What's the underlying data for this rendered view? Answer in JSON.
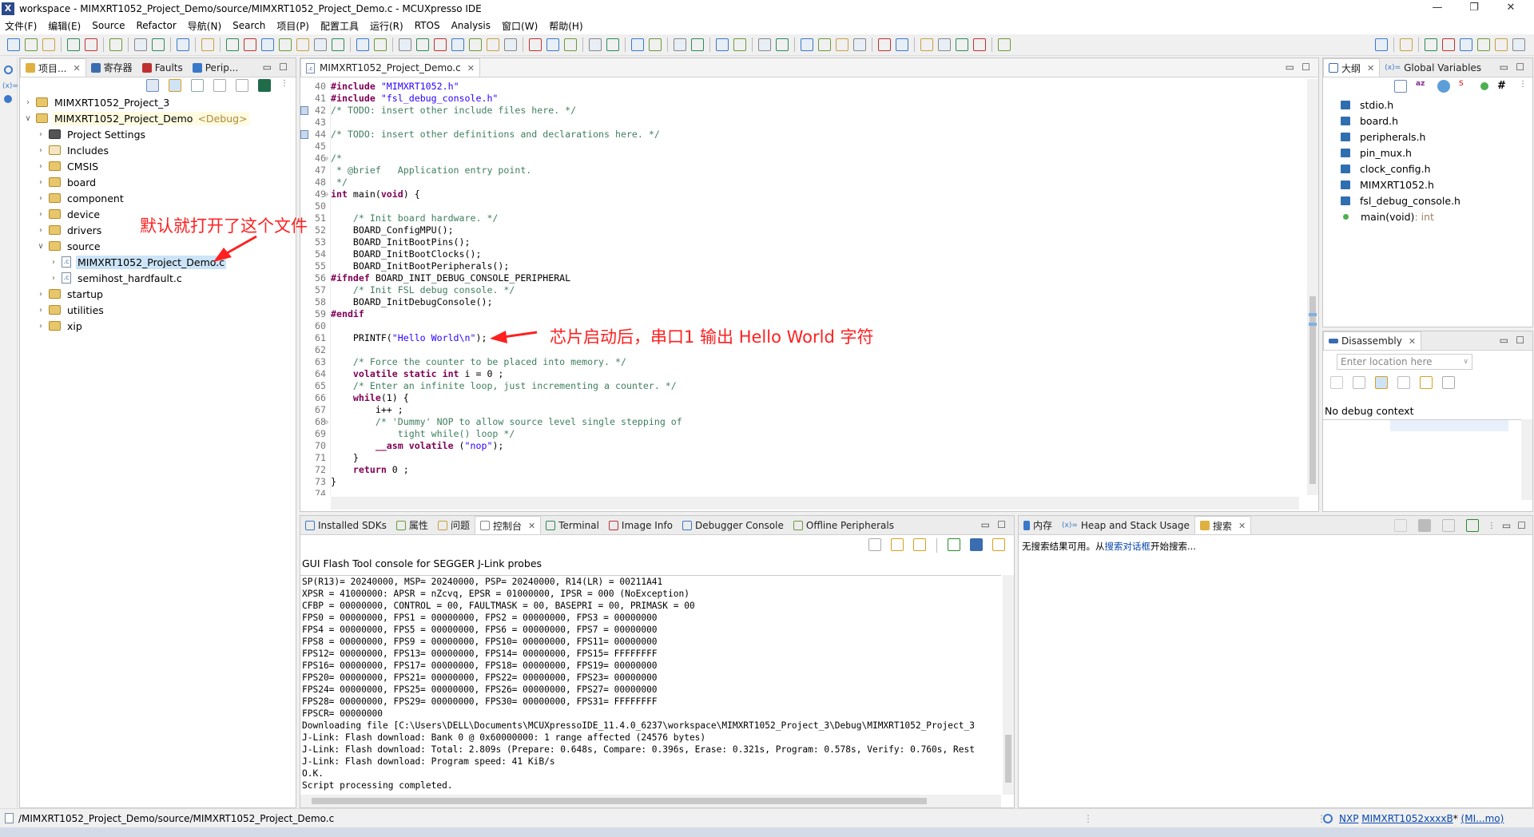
{
  "window": {
    "title": "workspace - MIMXRT1052_Project_Demo/source/MIMXRT1052_Project_Demo.c - MCUXpresso IDE",
    "logo": "X",
    "minimize": "—",
    "restore": "❐",
    "close": "✕"
  },
  "menu": [
    "文件(F)",
    "编辑(E)",
    "Source",
    "Refactor",
    "导航(N)",
    "Search",
    "项目(P)",
    "配置工具",
    "运行(R)",
    "RTOS",
    "Analysis",
    "窗口(W)",
    "帮助(H)"
  ],
  "toolbar_icons": [
    "new-icon",
    "save-icon",
    "save-all-icon",
    "sep",
    "build-config-icon",
    "build-icon",
    "sep",
    "binary-icon",
    "sep",
    "undo-icon",
    "redo-icon",
    "sep",
    "terminal-icon",
    "sep",
    "debug-skip-icon",
    "sep",
    "resume-icon",
    "suspend-icon",
    "stop-icon",
    "disconnect-icon",
    "step-into-icon",
    "step-over-icon",
    "step-return-icon",
    "sep",
    "instruction-step-icon",
    "drop-frame-icon",
    "sep",
    "restart-icon",
    "split-icon",
    "copy-icon",
    "step-icon",
    "step2-icon",
    "step3-icon",
    "step-out-icon",
    "sep",
    "mcuxpresso-icon",
    "globe-icon",
    "home-icon",
    "sep",
    "link-icon",
    "probe-icon",
    "sep",
    "chip-icon",
    "erase-icon",
    "sep",
    "debug-icon",
    "debug-attach-icon",
    "sep",
    "run-icon",
    "run-external-icon",
    "sep",
    "open-project-icon",
    "pen-icon",
    "sep",
    "highlight-icon",
    "annotate-icon",
    "doc-icon",
    "pilcrow-icon",
    "sep",
    "next-annotation-icon",
    "prev-annotation-icon",
    "sep",
    "back-icon",
    "forward-icon",
    "nav-back-icon",
    "nav-forward-icon",
    "sep",
    "new-window-icon"
  ],
  "toolbar_right_icons": [
    "search-icon",
    "sep",
    "perspective-icon",
    "sep",
    "develop-perspective-icon",
    "chip-perspective-icon",
    "signal-icon",
    "usb-icon",
    "shield-icon",
    "binary-perspective-icon"
  ],
  "left_panel": {
    "tabs": [
      "项目...",
      "寄存器",
      "Faults",
      "Perip..."
    ],
    "tree": [
      {
        "label": "MIMXRT1052_Project_3",
        "level": 0,
        "expanded": false,
        "type": "project"
      },
      {
        "label": "MIMXRT1052_Project_Demo",
        "suffix": "<Debug>",
        "level": 0,
        "expanded": true,
        "type": "project"
      },
      {
        "label": "Project Settings",
        "level": 1,
        "type": "settings"
      },
      {
        "label": "Includes",
        "level": 1,
        "type": "includes"
      },
      {
        "label": "CMSIS",
        "level": 1,
        "type": "folder"
      },
      {
        "label": "board",
        "level": 1,
        "type": "folder"
      },
      {
        "label": "component",
        "level": 1,
        "type": "folder"
      },
      {
        "label": "device",
        "level": 1,
        "type": "folder"
      },
      {
        "label": "drivers",
        "level": 1,
        "type": "folder"
      },
      {
        "label": "source",
        "level": 1,
        "type": "folder",
        "expanded": true
      },
      {
        "label": "MIMXRT1052_Project_Demo.c",
        "level": 2,
        "type": "cfile",
        "selected": true
      },
      {
        "label": "semihost_hardfault.c",
        "level": 2,
        "type": "cfile"
      },
      {
        "label": "startup",
        "level": 1,
        "type": "folder"
      },
      {
        "label": "utilities",
        "level": 1,
        "type": "folder"
      },
      {
        "label": "xip",
        "level": 1,
        "type": "folder"
      }
    ]
  },
  "editor": {
    "tab": "MIMXRT1052_Project_Demo.c",
    "lines": [
      {
        "n": "40",
        "segs": [
          [
            "k",
            "#include "
          ],
          [
            "s",
            "\"MIMXRT1052.h\""
          ]
        ]
      },
      {
        "n": "41",
        "segs": [
          [
            "k",
            "#include "
          ],
          [
            "s",
            "\"fsl_debug_console.h\""
          ]
        ]
      },
      {
        "n": "42",
        "segs": [
          [
            "c",
            "/* TODO: insert other include files here. */"
          ]
        ]
      },
      {
        "n": "43",
        "segs": []
      },
      {
        "n": "44",
        "segs": [
          [
            "c",
            "/* TODO: insert other definitions and declarations here. */"
          ]
        ]
      },
      {
        "n": "45",
        "segs": []
      },
      {
        "n": "46",
        "segs": [
          [
            "c",
            "/*"
          ]
        ]
      },
      {
        "n": "47",
        "segs": [
          [
            "c",
            " * @brief   Application entry point."
          ]
        ]
      },
      {
        "n": "48",
        "segs": [
          [
            "c",
            " */"
          ]
        ]
      },
      {
        "n": "49",
        "segs": [
          [
            "k",
            "int "
          ],
          [
            "p",
            "main("
          ],
          [
            "k",
            "void"
          ],
          [
            "p",
            ") {"
          ]
        ]
      },
      {
        "n": "50",
        "segs": []
      },
      {
        "n": "51",
        "segs": [
          [
            "c",
            "    /* Init board hardware. */"
          ]
        ]
      },
      {
        "n": "52",
        "segs": [
          [
            "p",
            "    BOARD_ConfigMPU();"
          ]
        ]
      },
      {
        "n": "53",
        "segs": [
          [
            "p",
            "    BOARD_InitBootPins();"
          ]
        ]
      },
      {
        "n": "54",
        "segs": [
          [
            "p",
            "    BOARD_InitBootClocks();"
          ]
        ]
      },
      {
        "n": "55",
        "segs": [
          [
            "p",
            "    BOARD_InitBootPeripherals();"
          ]
        ]
      },
      {
        "n": "56",
        "segs": [
          [
            "k",
            "#ifndef "
          ],
          [
            "p",
            "BOARD_INIT_DEBUG_CONSOLE_PERIPHERAL"
          ]
        ]
      },
      {
        "n": "57",
        "segs": [
          [
            "c",
            "    /* Init FSL debug console. */"
          ]
        ]
      },
      {
        "n": "58",
        "segs": [
          [
            "p",
            "    BOARD_InitDebugConsole();"
          ]
        ]
      },
      {
        "n": "59",
        "segs": [
          [
            "k",
            "#endif"
          ]
        ]
      },
      {
        "n": "60",
        "segs": []
      },
      {
        "n": "61",
        "segs": [
          [
            "p",
            "    PRINTF("
          ],
          [
            "s",
            "\"Hello World\\n\""
          ],
          [
            "p",
            ");"
          ]
        ]
      },
      {
        "n": "62",
        "segs": []
      },
      {
        "n": "63",
        "segs": [
          [
            "c",
            "    /* Force the counter to be placed into memory. */"
          ]
        ]
      },
      {
        "n": "64",
        "segs": [
          [
            "k",
            "    volatile static int "
          ],
          [
            "p",
            "i = 0 ;"
          ]
        ]
      },
      {
        "n": "65",
        "segs": [
          [
            "c",
            "    /* Enter an infinite loop, just incrementing a counter. */"
          ]
        ]
      },
      {
        "n": "66",
        "segs": [
          [
            "k",
            "    while"
          ],
          [
            "p",
            "(1) {"
          ]
        ]
      },
      {
        "n": "67",
        "segs": [
          [
            "p",
            "        i++ ;"
          ]
        ]
      },
      {
        "n": "68",
        "segs": [
          [
            "c",
            "        /* 'Dummy' NOP to allow source level single stepping of"
          ]
        ]
      },
      {
        "n": "69",
        "segs": [
          [
            "c",
            "            tight while() loop */"
          ]
        ]
      },
      {
        "n": "70",
        "segs": [
          [
            "k",
            "        __asm volatile "
          ],
          [
            "p",
            "("
          ],
          [
            "s",
            "\"nop\""
          ],
          [
            "p",
            ");"
          ]
        ]
      },
      {
        "n": "71",
        "segs": [
          [
            "p",
            "    }"
          ]
        ]
      },
      {
        "n": "72",
        "segs": [
          [
            "k",
            "    return "
          ],
          [
            "p",
            "0 ;"
          ]
        ]
      },
      {
        "n": "73",
        "segs": [
          [
            "p",
            "}"
          ]
        ]
      },
      {
        "n": "74",
        "segs": []
      }
    ]
  },
  "annotations": {
    "file_opened": "默认就打开了这个文件",
    "hello_world": "芯片启动后，串口1 输出 Hello World 字符",
    "color": "#ff2020"
  },
  "outline": {
    "tabs": [
      "大纲",
      "Global Variables"
    ],
    "items": [
      "stdio.h",
      "board.h",
      "peripherals.h",
      "pin_mux.h",
      "clock_config.h",
      "MIMXRT1052.h",
      "fsl_debug_console.h"
    ],
    "main_item": "main(void)",
    "main_type": " : int"
  },
  "disassembly": {
    "tab": "Disassembly",
    "location_placeholder": "Enter location here",
    "no_context": "No debug context"
  },
  "console": {
    "tabs": [
      "Installed SDKs",
      "属性",
      "问题",
      "控制台",
      "Terminal",
      "Image Info",
      "Debugger Console",
      "Offline Peripherals"
    ],
    "active_tab": 3,
    "header": "GUI Flash Tool console for SEGGER J-Link probes",
    "lines": [
      "SP(R13)= 20240000, MSP= 20240000, PSP= 20240000, R14(LR) = 00211A41",
      "XPSR = 41000000: APSR = nZcvq, EPSR = 01000000, IPSR = 000 (NoException)",
      "CFBP = 00000000, CONTROL = 00, FAULTMASK = 00, BASEPRI = 00, PRIMASK = 00",
      "FPS0 = 00000000, FPS1 = 00000000, FPS2 = 00000000, FPS3 = 00000000",
      "FPS4 = 00000000, FPS5 = 00000000, FPS6 = 00000000, FPS7 = 00000000",
      "FPS8 = 00000000, FPS9 = 00000000, FPS10= 00000000, FPS11= 00000000",
      "FPS12= 00000000, FPS13= 00000000, FPS14= 00000000, FPS15= FFFFFFFF",
      "FPS16= 00000000, FPS17= 00000000, FPS18= 00000000, FPS19= 00000000",
      "FPS20= 00000000, FPS21= 00000000, FPS22= 00000000, FPS23= 00000000",
      "FPS24= 00000000, FPS25= 00000000, FPS26= 00000000, FPS27= 00000000",
      "FPS28= 00000000, FPS29= 00000000, FPS30= 00000000, FPS31= FFFFFFFF",
      "FPSCR= 00000000",
      "Downloading file [C:\\Users\\DELL\\Documents\\MCUXpressoIDE_11.4.0_6237\\workspace\\MIMXRT1052_Project_3\\Debug\\MIMXRT1052_Project_3",
      "J-Link: Flash download: Bank 0 @ 0x60000000: 1 range affected (24576 bytes)",
      "J-Link: Flash download: Total: 2.809s (Prepare: 0.648s, Compare: 0.396s, Erase: 0.321s, Program: 0.578s, Verify: 0.760s, Rest",
      "J-Link: Flash download: Program speed: 41 KiB/s",
      "O.K.",
      "Script processing completed."
    ]
  },
  "search": {
    "tabs": [
      "内存",
      "Heap and Stack Usage",
      "搜索"
    ],
    "msg_prefix": "无搜索结果可用。从",
    "msg_link": "搜索对话框",
    "msg_suffix": "开始搜索..."
  },
  "status": {
    "path": "/MIMXRT1052_Project_Demo/source/MIMXRT1052_Project_Demo.c",
    "vendor": "NXP",
    "device": "MIMXRT1052xxxxB",
    "device_suffix": "*",
    "project": "(MI...mo)"
  }
}
